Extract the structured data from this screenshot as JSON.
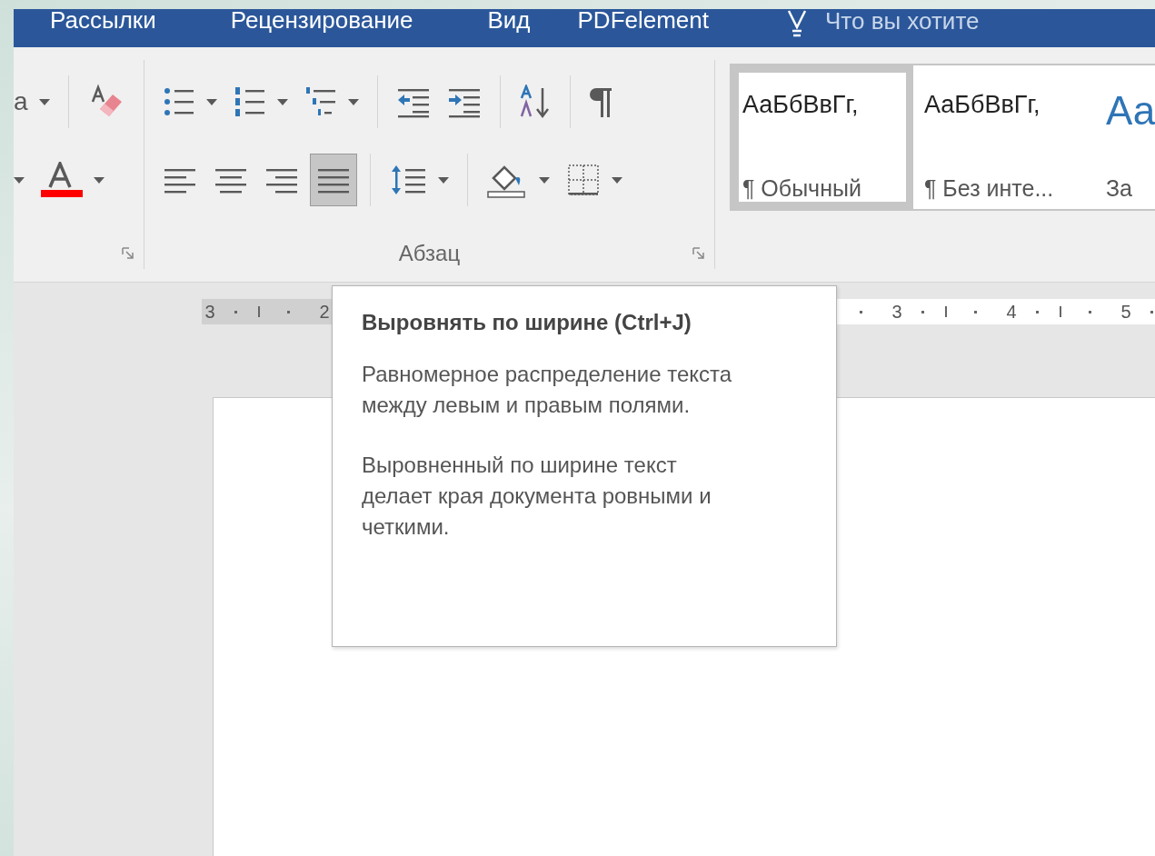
{
  "tabs": [
    {
      "label": "Рассылки",
      "selected": false
    },
    {
      "label": "Рецензирование",
      "selected": false
    },
    {
      "label": "Вид",
      "selected": false
    },
    {
      "label": "PDFelement",
      "selected": false
    }
  ],
  "tell_me": {
    "text": "Что вы хотите"
  },
  "ribbon": {
    "font_group": {
      "cut_label": "а",
      "rows": [
        [
          {
            "kind": "case",
            "dropdown": true
          },
          {
            "kind": "separator"
          },
          {
            "kind": "clear-format",
            "dropdown": false
          }
        ],
        [
          {
            "kind": "caret-only",
            "dropdown": true
          },
          {
            "kind": "font-color",
            "dropdown": true
          }
        ]
      ]
    },
    "paragraph_group": {
      "label": "Абзац",
      "rows": [
        [
          {
            "kind": "bullets",
            "dropdown": true,
            "selected": false
          },
          {
            "kind": "numbering",
            "dropdown": true,
            "selected": false
          },
          {
            "kind": "multilevel",
            "dropdown": true,
            "selected": false
          },
          {
            "kind": "separator"
          },
          {
            "kind": "outdent",
            "dropdown": false,
            "selected": false
          },
          {
            "kind": "indent",
            "dropdown": false,
            "selected": false
          },
          {
            "kind": "separator"
          },
          {
            "kind": "sort",
            "dropdown": false,
            "selected": false
          },
          {
            "kind": "separator"
          },
          {
            "kind": "pilcrow",
            "dropdown": false,
            "selected": false
          }
        ],
        [
          {
            "kind": "align-left",
            "dropdown": false,
            "selected": false
          },
          {
            "kind": "align-center",
            "dropdown": false,
            "selected": false
          },
          {
            "kind": "align-right",
            "dropdown": false,
            "selected": false
          },
          {
            "kind": "justify",
            "dropdown": false,
            "selected": true
          },
          {
            "kind": "separator"
          },
          {
            "kind": "line-spacing",
            "dropdown": true,
            "selected": false
          },
          {
            "kind": "separator"
          },
          {
            "kind": "shading",
            "dropdown": true,
            "selected": false
          },
          {
            "kind": "borders",
            "dropdown": true,
            "selected": false
          }
        ]
      ]
    },
    "styles": [
      {
        "sample": "АаБбВвГг,",
        "name": "¶ Обычный",
        "kind": "normal",
        "selected": true
      },
      {
        "sample": "АаБбВвГг,",
        "name": "¶ Без инте...",
        "kind": "normal",
        "selected": false
      },
      {
        "sample": "Аа",
        "name": "За",
        "kind": "heading",
        "selected": false
      }
    ]
  },
  "ruler": {
    "left_numbers": [
      "3",
      "2"
    ],
    "right_numbers": [
      "3",
      "4",
      "5"
    ]
  },
  "tooltip": {
    "title": "Выровнять по ширине (Ctrl+J)",
    "paragraphs": [
      "Равномерное распределение текста между левым и правым полями.",
      "Выровненный по ширине текст делает края документа ровными и четкими."
    ]
  }
}
